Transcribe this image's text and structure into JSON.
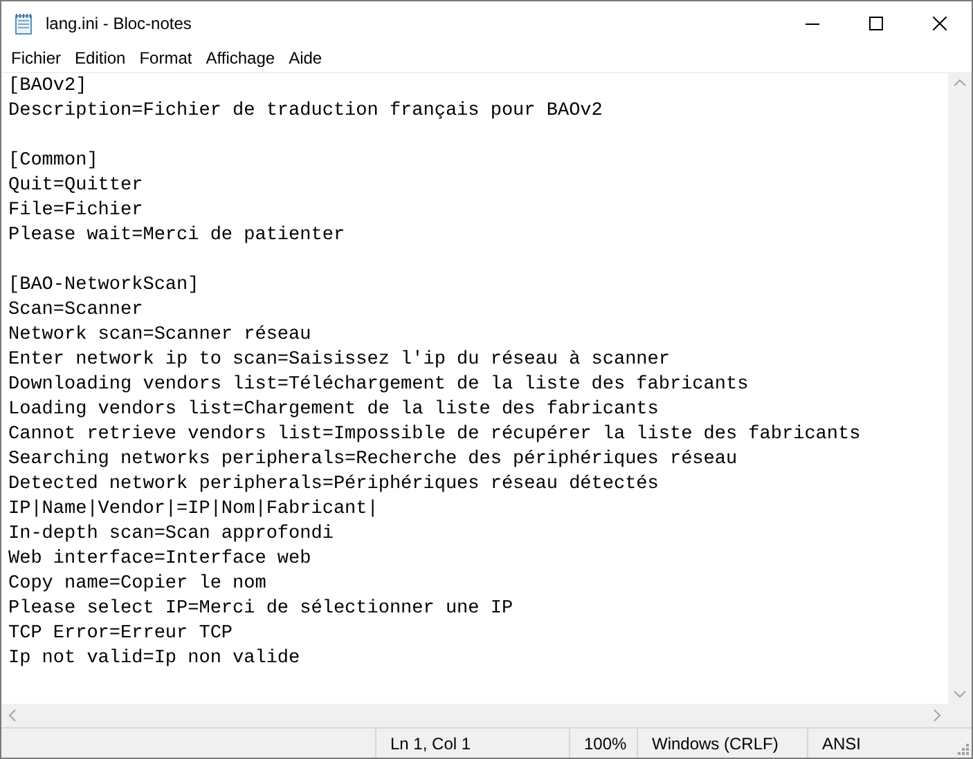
{
  "window": {
    "title": "lang.ini - Bloc-notes"
  },
  "menu": [
    "Fichier",
    "Edition",
    "Format",
    "Affichage",
    "Aide"
  ],
  "document": {
    "blocks": [
      [
        "[BAOv2]",
        "Description=Fichier de traduction français pour BAOv2"
      ],
      [
        "[Common]",
        "Quit=Quitter",
        "File=Fichier",
        "Please wait=Merci de patienter"
      ],
      [
        "[BAO-NetworkScan]",
        "Scan=Scanner",
        "Network scan=Scanner réseau",
        "Enter network ip to scan=Saisissez l'ip du réseau à scanner",
        "Downloading vendors list=Téléchargement de la liste des fabricants",
        "Loading vendors list=Chargement de la liste des fabricants",
        "Cannot retrieve vendors list=Impossible de récupérer la liste des fabricants",
        "Searching networks peripherals=Recherche des périphériques réseau",
        "Detected network peripherals=Périphériques réseau détectés",
        "IP|Name|Vendor|=IP|Nom|Fabricant|",
        "In-depth scan=Scan approfondi",
        "Web interface=Interface web",
        "Copy name=Copier le nom",
        "Please select IP=Merci de sélectionner une IP",
        "TCP Error=Erreur TCP",
        "Ip not valid=Ip non valide"
      ]
    ]
  },
  "status_bar": [
    "Ln 1, Col 1",
    "100%",
    "Windows (CRLF)",
    "ANSI"
  ]
}
